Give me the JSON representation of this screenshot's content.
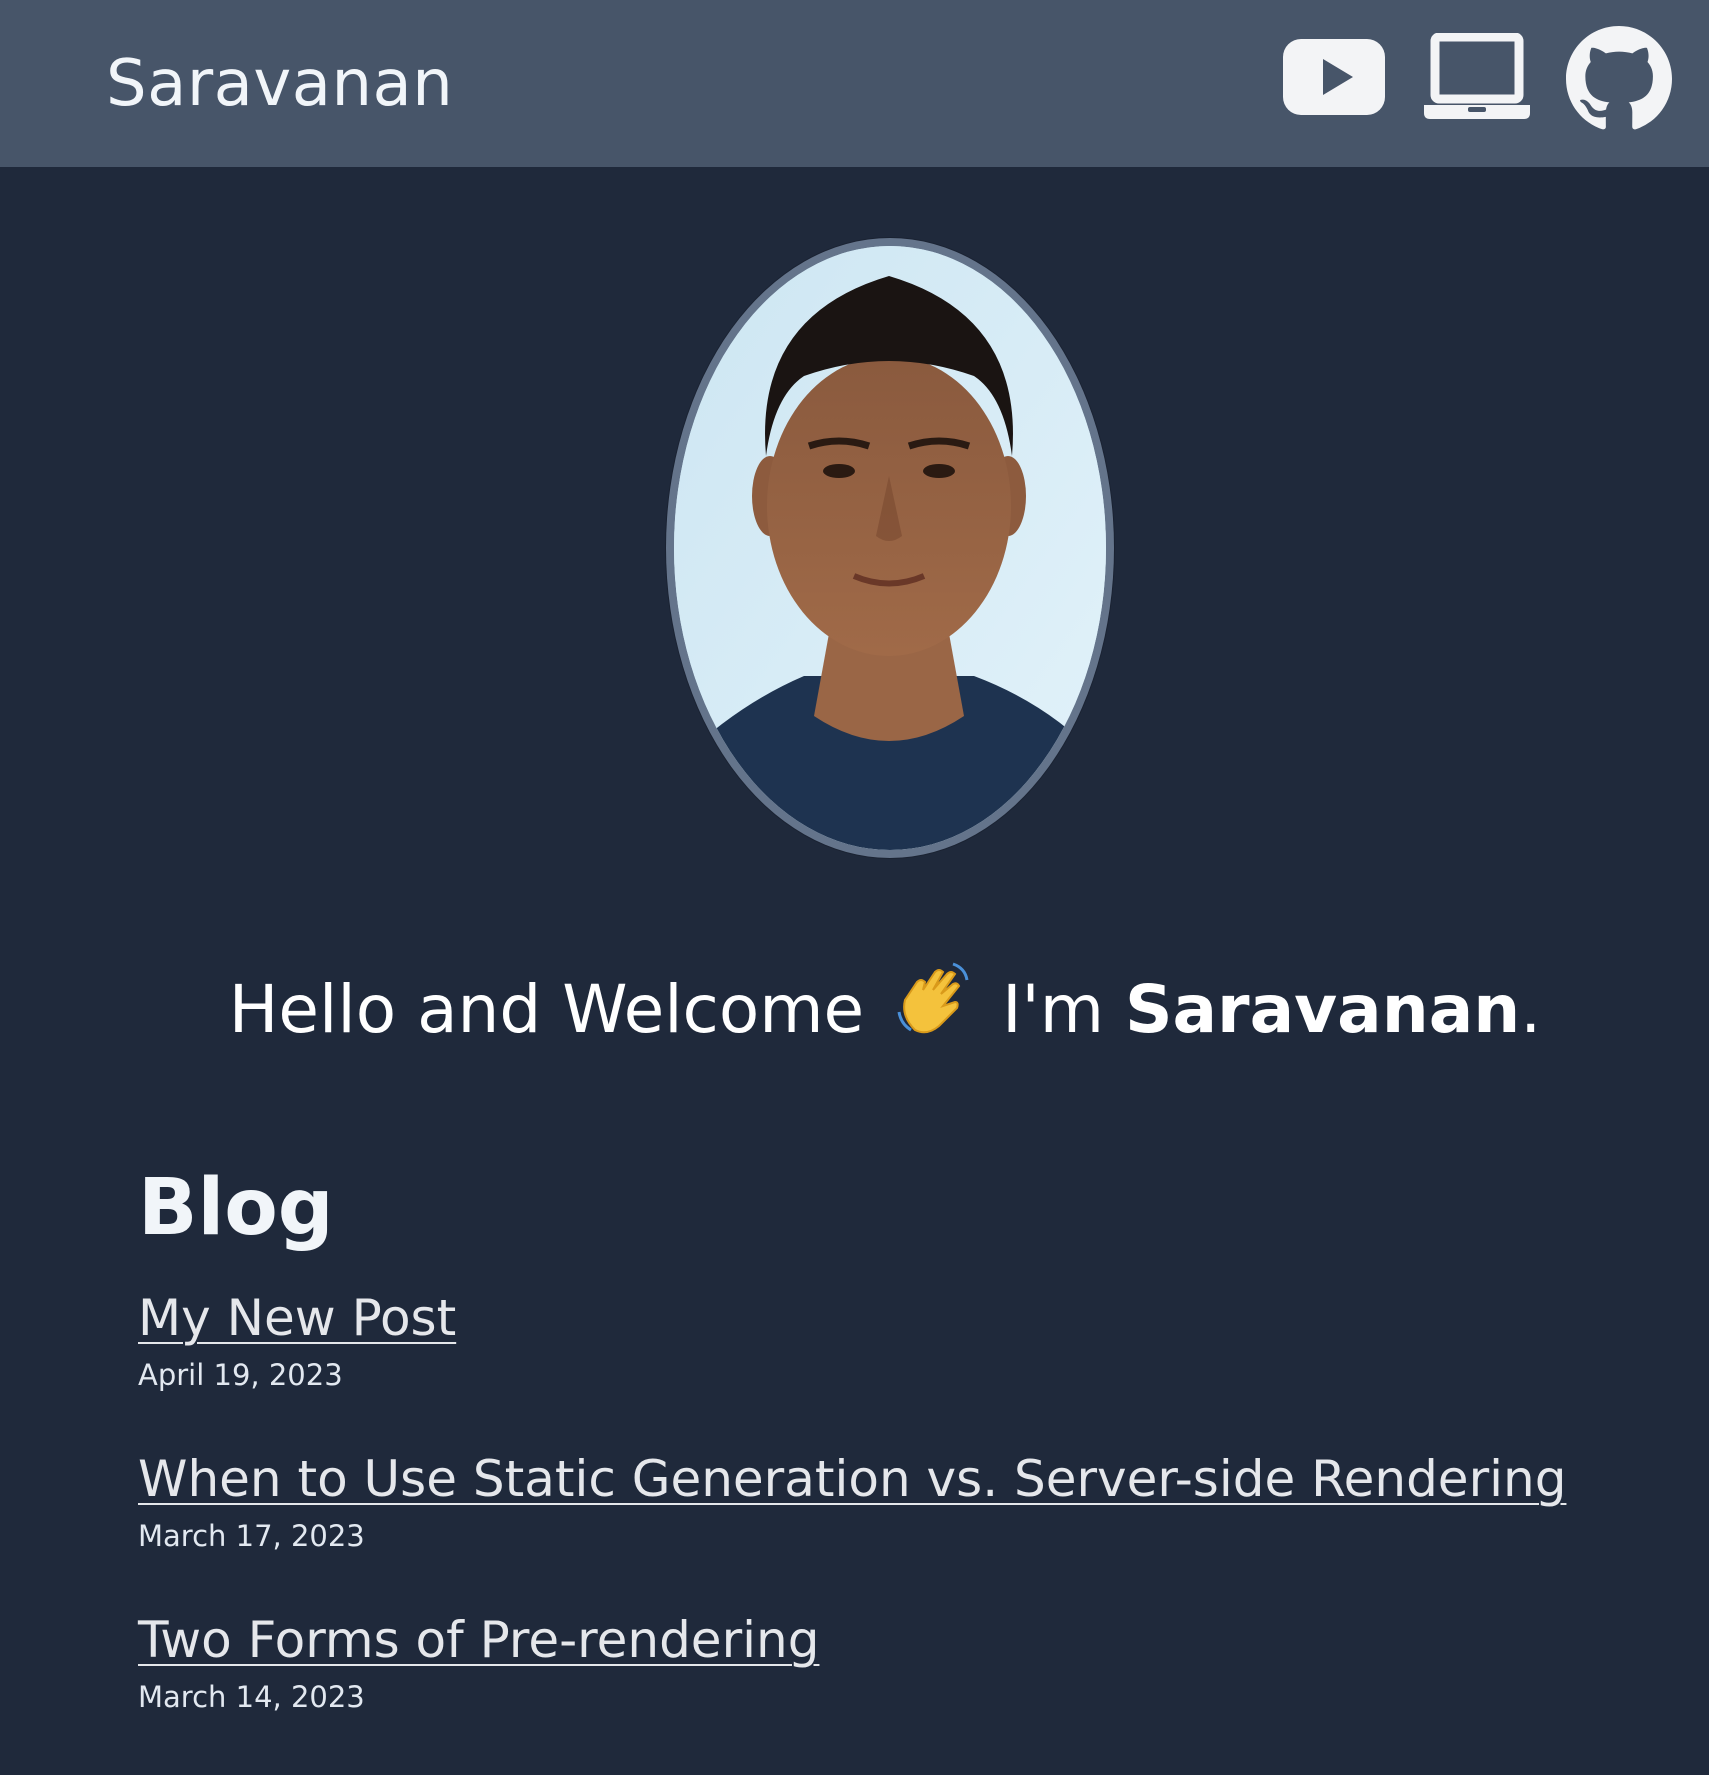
{
  "header": {
    "site_name": "Saravanan",
    "icons": [
      "youtube-icon",
      "laptop-icon",
      "github-icon"
    ],
    "background": "#475569"
  },
  "hero": {
    "greeting_prefix": "Hello and Welcome",
    "wave_emoji": "👋",
    "intro_prefix": "I'm",
    "name": "Saravanan",
    "suffix": "."
  },
  "blog": {
    "title": "Blog",
    "posts": [
      {
        "title": "My New Post",
        "date": "April 19, 2023"
      },
      {
        "title": "When to Use Static Generation vs. Server-side Rendering",
        "date": "March 17, 2023"
      },
      {
        "title": "Two Forms of Pre-rendering",
        "date": "March 14, 2023"
      }
    ]
  },
  "colors": {
    "page_background": "#1f293b",
    "header_background": "#475569",
    "avatar_border": "#64748b",
    "text": "#ffffff"
  }
}
